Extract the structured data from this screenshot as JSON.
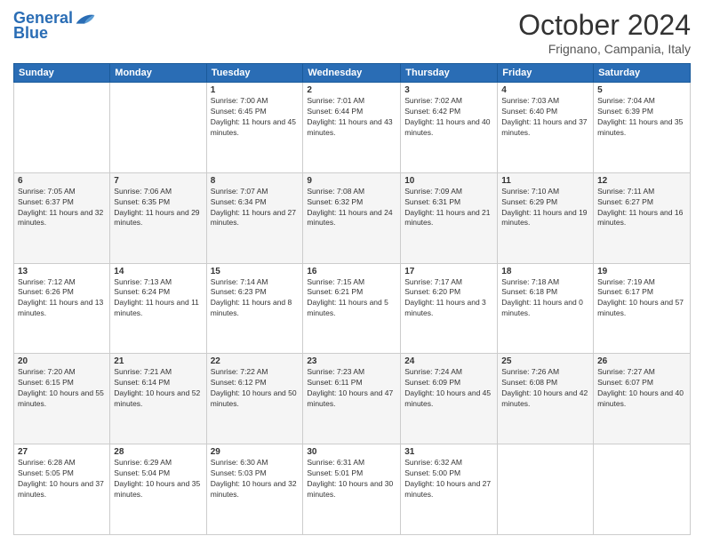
{
  "header": {
    "logo_line1": "General",
    "logo_line2": "Blue",
    "month": "October 2024",
    "location": "Frignano, Campania, Italy"
  },
  "weekdays": [
    "Sunday",
    "Monday",
    "Tuesday",
    "Wednesday",
    "Thursday",
    "Friday",
    "Saturday"
  ],
  "weeks": [
    [
      {
        "day": "",
        "sunrise": "",
        "sunset": "",
        "daylight": ""
      },
      {
        "day": "",
        "sunrise": "",
        "sunset": "",
        "daylight": ""
      },
      {
        "day": "1",
        "sunrise": "Sunrise: 7:00 AM",
        "sunset": "Sunset: 6:45 PM",
        "daylight": "Daylight: 11 hours and 45 minutes."
      },
      {
        "day": "2",
        "sunrise": "Sunrise: 7:01 AM",
        "sunset": "Sunset: 6:44 PM",
        "daylight": "Daylight: 11 hours and 43 minutes."
      },
      {
        "day": "3",
        "sunrise": "Sunrise: 7:02 AM",
        "sunset": "Sunset: 6:42 PM",
        "daylight": "Daylight: 11 hours and 40 minutes."
      },
      {
        "day": "4",
        "sunrise": "Sunrise: 7:03 AM",
        "sunset": "Sunset: 6:40 PM",
        "daylight": "Daylight: 11 hours and 37 minutes."
      },
      {
        "day": "5",
        "sunrise": "Sunrise: 7:04 AM",
        "sunset": "Sunset: 6:39 PM",
        "daylight": "Daylight: 11 hours and 35 minutes."
      }
    ],
    [
      {
        "day": "6",
        "sunrise": "Sunrise: 7:05 AM",
        "sunset": "Sunset: 6:37 PM",
        "daylight": "Daylight: 11 hours and 32 minutes."
      },
      {
        "day": "7",
        "sunrise": "Sunrise: 7:06 AM",
        "sunset": "Sunset: 6:35 PM",
        "daylight": "Daylight: 11 hours and 29 minutes."
      },
      {
        "day": "8",
        "sunrise": "Sunrise: 7:07 AM",
        "sunset": "Sunset: 6:34 PM",
        "daylight": "Daylight: 11 hours and 27 minutes."
      },
      {
        "day": "9",
        "sunrise": "Sunrise: 7:08 AM",
        "sunset": "Sunset: 6:32 PM",
        "daylight": "Daylight: 11 hours and 24 minutes."
      },
      {
        "day": "10",
        "sunrise": "Sunrise: 7:09 AM",
        "sunset": "Sunset: 6:31 PM",
        "daylight": "Daylight: 11 hours and 21 minutes."
      },
      {
        "day": "11",
        "sunrise": "Sunrise: 7:10 AM",
        "sunset": "Sunset: 6:29 PM",
        "daylight": "Daylight: 11 hours and 19 minutes."
      },
      {
        "day": "12",
        "sunrise": "Sunrise: 7:11 AM",
        "sunset": "Sunset: 6:27 PM",
        "daylight": "Daylight: 11 hours and 16 minutes."
      }
    ],
    [
      {
        "day": "13",
        "sunrise": "Sunrise: 7:12 AM",
        "sunset": "Sunset: 6:26 PM",
        "daylight": "Daylight: 11 hours and 13 minutes."
      },
      {
        "day": "14",
        "sunrise": "Sunrise: 7:13 AM",
        "sunset": "Sunset: 6:24 PM",
        "daylight": "Daylight: 11 hours and 11 minutes."
      },
      {
        "day": "15",
        "sunrise": "Sunrise: 7:14 AM",
        "sunset": "Sunset: 6:23 PM",
        "daylight": "Daylight: 11 hours and 8 minutes."
      },
      {
        "day": "16",
        "sunrise": "Sunrise: 7:15 AM",
        "sunset": "Sunset: 6:21 PM",
        "daylight": "Daylight: 11 hours and 5 minutes."
      },
      {
        "day": "17",
        "sunrise": "Sunrise: 7:17 AM",
        "sunset": "Sunset: 6:20 PM",
        "daylight": "Daylight: 11 hours and 3 minutes."
      },
      {
        "day": "18",
        "sunrise": "Sunrise: 7:18 AM",
        "sunset": "Sunset: 6:18 PM",
        "daylight": "Daylight: 11 hours and 0 minutes."
      },
      {
        "day": "19",
        "sunrise": "Sunrise: 7:19 AM",
        "sunset": "Sunset: 6:17 PM",
        "daylight": "Daylight: 10 hours and 57 minutes."
      }
    ],
    [
      {
        "day": "20",
        "sunrise": "Sunrise: 7:20 AM",
        "sunset": "Sunset: 6:15 PM",
        "daylight": "Daylight: 10 hours and 55 minutes."
      },
      {
        "day": "21",
        "sunrise": "Sunrise: 7:21 AM",
        "sunset": "Sunset: 6:14 PM",
        "daylight": "Daylight: 10 hours and 52 minutes."
      },
      {
        "day": "22",
        "sunrise": "Sunrise: 7:22 AM",
        "sunset": "Sunset: 6:12 PM",
        "daylight": "Daylight: 10 hours and 50 minutes."
      },
      {
        "day": "23",
        "sunrise": "Sunrise: 7:23 AM",
        "sunset": "Sunset: 6:11 PM",
        "daylight": "Daylight: 10 hours and 47 minutes."
      },
      {
        "day": "24",
        "sunrise": "Sunrise: 7:24 AM",
        "sunset": "Sunset: 6:09 PM",
        "daylight": "Daylight: 10 hours and 45 minutes."
      },
      {
        "day": "25",
        "sunrise": "Sunrise: 7:26 AM",
        "sunset": "Sunset: 6:08 PM",
        "daylight": "Daylight: 10 hours and 42 minutes."
      },
      {
        "day": "26",
        "sunrise": "Sunrise: 7:27 AM",
        "sunset": "Sunset: 6:07 PM",
        "daylight": "Daylight: 10 hours and 40 minutes."
      }
    ],
    [
      {
        "day": "27",
        "sunrise": "Sunrise: 6:28 AM",
        "sunset": "Sunset: 5:05 PM",
        "daylight": "Daylight: 10 hours and 37 minutes."
      },
      {
        "day": "28",
        "sunrise": "Sunrise: 6:29 AM",
        "sunset": "Sunset: 5:04 PM",
        "daylight": "Daylight: 10 hours and 35 minutes."
      },
      {
        "day": "29",
        "sunrise": "Sunrise: 6:30 AM",
        "sunset": "Sunset: 5:03 PM",
        "daylight": "Daylight: 10 hours and 32 minutes."
      },
      {
        "day": "30",
        "sunrise": "Sunrise: 6:31 AM",
        "sunset": "Sunset: 5:01 PM",
        "daylight": "Daylight: 10 hours and 30 minutes."
      },
      {
        "day": "31",
        "sunrise": "Sunrise: 6:32 AM",
        "sunset": "Sunset: 5:00 PM",
        "daylight": "Daylight: 10 hours and 27 minutes."
      },
      {
        "day": "",
        "sunrise": "",
        "sunset": "",
        "daylight": ""
      },
      {
        "day": "",
        "sunrise": "",
        "sunset": "",
        "daylight": ""
      }
    ]
  ]
}
